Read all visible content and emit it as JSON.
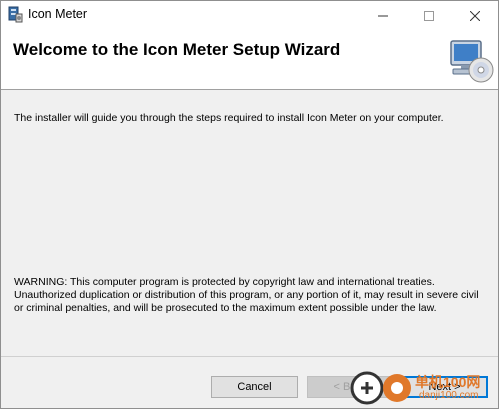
{
  "window": {
    "title": "Icon Meter",
    "controls": {
      "minimize_icon": "minimize-icon",
      "maximize_icon": "maximize-icon",
      "close_icon": "close-icon"
    }
  },
  "header": {
    "title": "Welcome to the Icon Meter Setup Wizard",
    "image_icon": "computer-cd-icon"
  },
  "body": {
    "intro": "The installer will guide you through the steps required to install Icon Meter on your computer.",
    "warning": "WARNING: This computer program is protected by copyright law and international treaties. Unauthorized duplication or distribution of this program, or any portion of it, may result in severe civil or criminal penalties, and will be prosecuted to the maximum extent possible under the law."
  },
  "footer": {
    "cancel_label": "Cancel",
    "back_label": "< Back",
    "next_label": "Next >"
  },
  "watermark": {
    "line1": "单机100网",
    "line2": "danji100.com"
  },
  "colors": {
    "accent": "#0078d7",
    "watermark": "#e0782a"
  }
}
